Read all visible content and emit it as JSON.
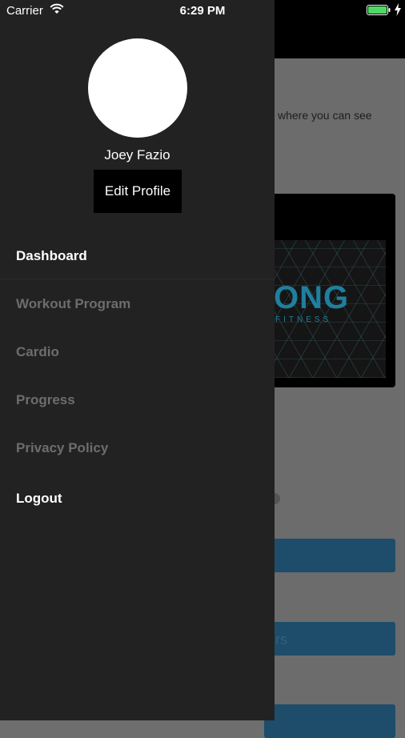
{
  "status_bar": {
    "carrier": "Carrier",
    "time": "6:29 PM"
  },
  "background": {
    "partial_text": "where you can see",
    "logo_text": "ONG",
    "logo_sub": "FITNESS",
    "button_partial": "rs"
  },
  "drawer": {
    "profile_name": "Joey Fazio",
    "edit_profile_label": "Edit Profile",
    "menu": [
      {
        "label": "Dashboard",
        "state": "active"
      },
      {
        "label": "Workout Program",
        "state": "inactive"
      },
      {
        "label": "Cardio",
        "state": "inactive"
      },
      {
        "label": "Progress",
        "state": "inactive"
      },
      {
        "label": "Privacy Policy",
        "state": "inactive"
      },
      {
        "label": "Logout",
        "state": "active"
      }
    ]
  },
  "colors": {
    "drawer_bg": "#222222",
    "accent_blue": "#1f7f9e",
    "inactive_text": "#6d6d6d"
  }
}
